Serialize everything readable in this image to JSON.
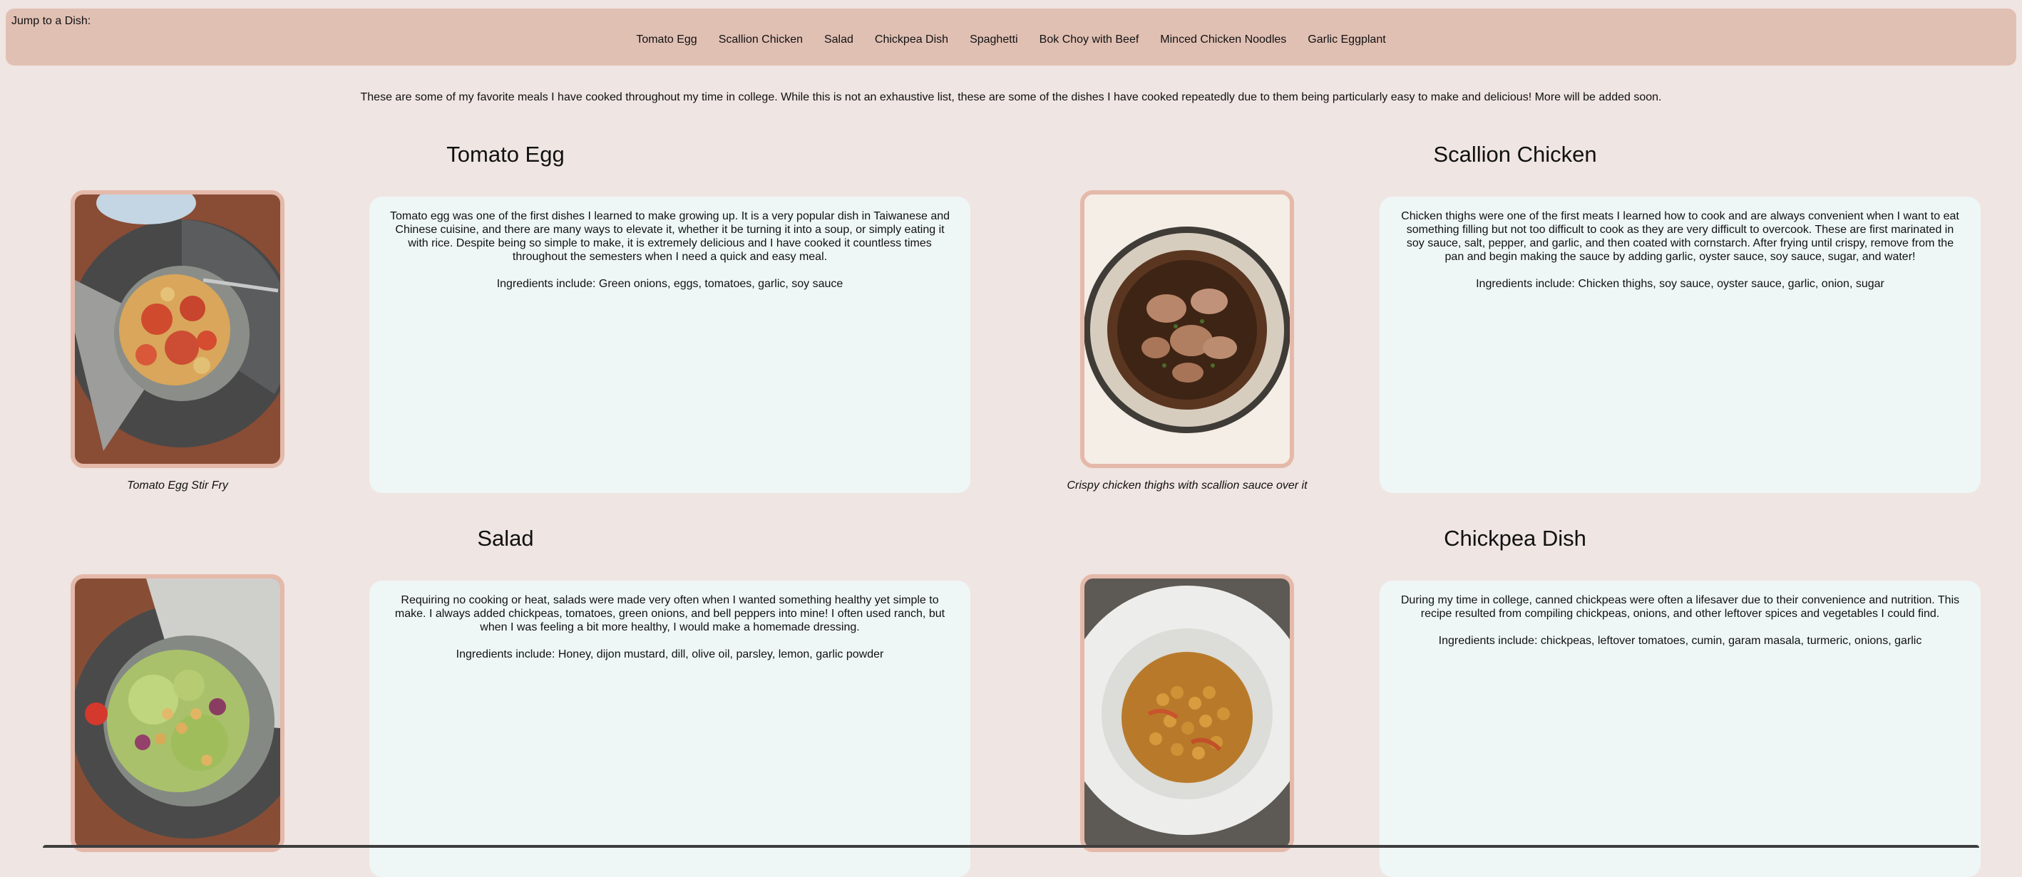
{
  "nav": {
    "title": "Jump to a Dish:",
    "links": [
      {
        "label": "Tomato Egg"
      },
      {
        "label": "Scallion Chicken"
      },
      {
        "label": "Salad"
      },
      {
        "label": "Chickpea Dish"
      },
      {
        "label": "Spaghetti"
      },
      {
        "label": "Bok Choy with Beef"
      },
      {
        "label": "Minced Chicken Noodles"
      },
      {
        "label": "Garlic Eggplant"
      }
    ]
  },
  "intro": "These are some of my favorite meals I have cooked throughout my time in college. While this is not an exhaustive list, these are some of the dishes I have cooked repeatedly due to them being particularly easy to make and delicious! More will be added soon.",
  "dishes": [
    {
      "title": "Tomato Egg",
      "caption": "Tomato Egg Stir Fry",
      "description": "Tomato egg was one of the first dishes I learned to make growing up. It is a very popular dish in Taiwanese and Chinese cuisine, and there are many ways to elevate it, whether it be turning it into a soup, or simply eating it with rice. Despite being so simple to make, it is extremely delicious and I have cooked it countless times throughout the semesters when I need a quick and easy meal.",
      "ingredients": "Ingredients include: Green onions, eggs, tomatoes, garlic, soy sauce"
    },
    {
      "title": "Scallion Chicken",
      "caption": "Crispy chicken thighs with scallion sauce over it",
      "description": "Chicken thighs were one of the first meats I learned how to cook and are always convenient when I want to eat something filling but not too difficult to cook as they are very difficult to overcook. These are first marinated in soy sauce, salt, pepper, and garlic, and then coated with cornstarch. After frying until crispy, remove from the pan and begin making the sauce by adding garlic, oyster sauce, soy sauce, sugar, and water!",
      "ingredients": "Ingredients include: Chicken thighs, soy sauce, oyster sauce, garlic, onion, sugar"
    },
    {
      "title": "Salad",
      "caption": "",
      "description": "Requiring no cooking or heat, salads were made very often when I wanted something healthy yet simple to make. I always added chickpeas, tomatoes, green onions, and bell peppers into mine! I often used ranch, but when I was feeling a bit more healthy, I would make a homemade dressing.",
      "ingredients": "Ingredients include: Honey, dijon mustard, dill, olive oil, parsley, lemon, garlic powder"
    },
    {
      "title": "Chickpea Dish",
      "caption": "",
      "description": "During my time in college, canned chickpeas were often a lifesaver due to their convenience and nutrition. This recipe resulted from compiling chickpeas, onions, and other leftover spices and vegetables I could find.",
      "ingredients": "Ingredients include: chickpeas, leftover tomatoes, cumin, garam masala, turmeric, onions, garlic"
    }
  ]
}
